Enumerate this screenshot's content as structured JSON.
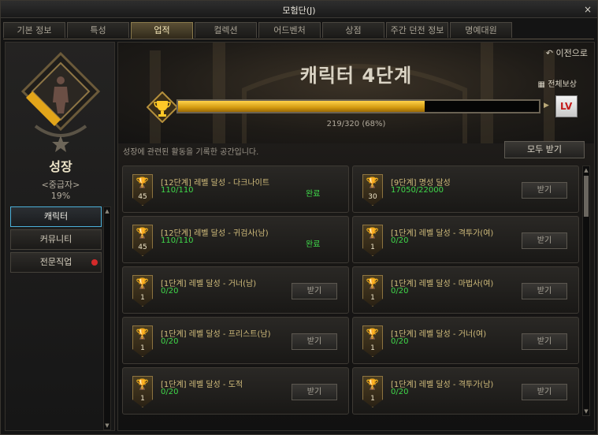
{
  "window": {
    "title": "모험단(J)",
    "close": "×"
  },
  "tabs": [
    {
      "label": "기본 정보",
      "active": false
    },
    {
      "label": "특성",
      "active": false
    },
    {
      "label": "업적",
      "active": true
    },
    {
      "label": "컬렉션",
      "active": false
    },
    {
      "label": "어드벤처",
      "active": false
    },
    {
      "label": "상점",
      "active": false
    },
    {
      "label": "주간 던전 정보",
      "active": false
    },
    {
      "label": "명예대원",
      "active": false
    }
  ],
  "category": {
    "name": "성장",
    "rank": "<중급자>",
    "percent": "19%",
    "items": [
      {
        "label": "캐릭터",
        "active": true,
        "alert": false
      },
      {
        "label": "커뮤니티",
        "active": false,
        "alert": false
      },
      {
        "label": "전문직업",
        "active": false,
        "alert": true
      }
    ]
  },
  "header": {
    "back": "이전으로",
    "stage_title": "캐릭터 4단계",
    "all_reward": "전체보상",
    "progress_text": "219/320 (68%)",
    "progress_fraction": 0.684,
    "reward_icon_label": "LV",
    "description": "성장에 관련된 활동을 기록한 공간입니다.",
    "claim_all": "모두 받기"
  },
  "achievements": [
    {
      "count": "45",
      "name": "[12단계] 레벨 달성 - 다크나이트",
      "progress": "110/110",
      "status": "완료",
      "button": ""
    },
    {
      "count": "30",
      "name": "[9단계] 명성 달성",
      "progress": "17050/22000",
      "status": "",
      "button": "받기"
    },
    {
      "count": "45",
      "name": "[12단계] 레벨 달성 - 귀검사(남)",
      "progress": "110/110",
      "status": "완료",
      "button": ""
    },
    {
      "count": "1",
      "name": "[1단계] 레벨 달성 - 격투가(여)",
      "progress": "0/20",
      "status": "",
      "button": "받기"
    },
    {
      "count": "1",
      "name": "[1단계] 레벨 달성 - 거너(남)",
      "progress": "0/20",
      "status": "",
      "button": "받기"
    },
    {
      "count": "1",
      "name": "[1단계] 레벨 달성 - 마법사(여)",
      "progress": "0/20",
      "status": "",
      "button": "받기"
    },
    {
      "count": "1",
      "name": "[1단계] 레벨 달성 - 프리스트(남)",
      "progress": "0/20",
      "status": "",
      "button": "받기"
    },
    {
      "count": "1",
      "name": "[1단계] 레벨 달성 - 거너(여)",
      "progress": "0/20",
      "status": "",
      "button": "받기"
    },
    {
      "count": "1",
      "name": "[1단계] 레벨 달성 - 도적",
      "progress": "0/20",
      "status": "",
      "button": "받기"
    },
    {
      "count": "1",
      "name": "[1단계] 레벨 달성 - 격투가(남)",
      "progress": "0/20",
      "status": "",
      "button": "받기"
    }
  ]
}
